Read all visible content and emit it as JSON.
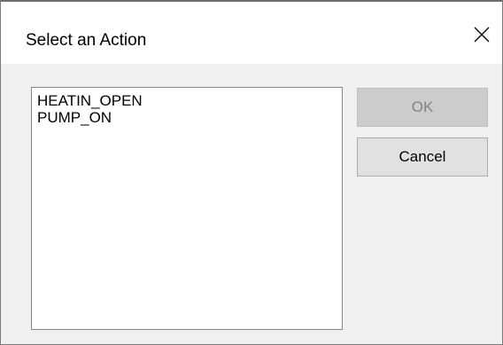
{
  "dialog": {
    "title": "Select an Action",
    "close_icon": "close-icon"
  },
  "actions_list": {
    "items": [
      "HEATIN_OPEN",
      "PUMP_ON"
    ]
  },
  "buttons": {
    "ok_label": "OK",
    "ok_enabled": false,
    "cancel_label": "Cancel"
  },
  "colors": {
    "dialog_background": "#f0f0f0",
    "titlebar_background": "#ffffff",
    "button_face": "#e1e1e1",
    "disabled_button_face": "#cccccc",
    "disabled_text": "#838383"
  }
}
